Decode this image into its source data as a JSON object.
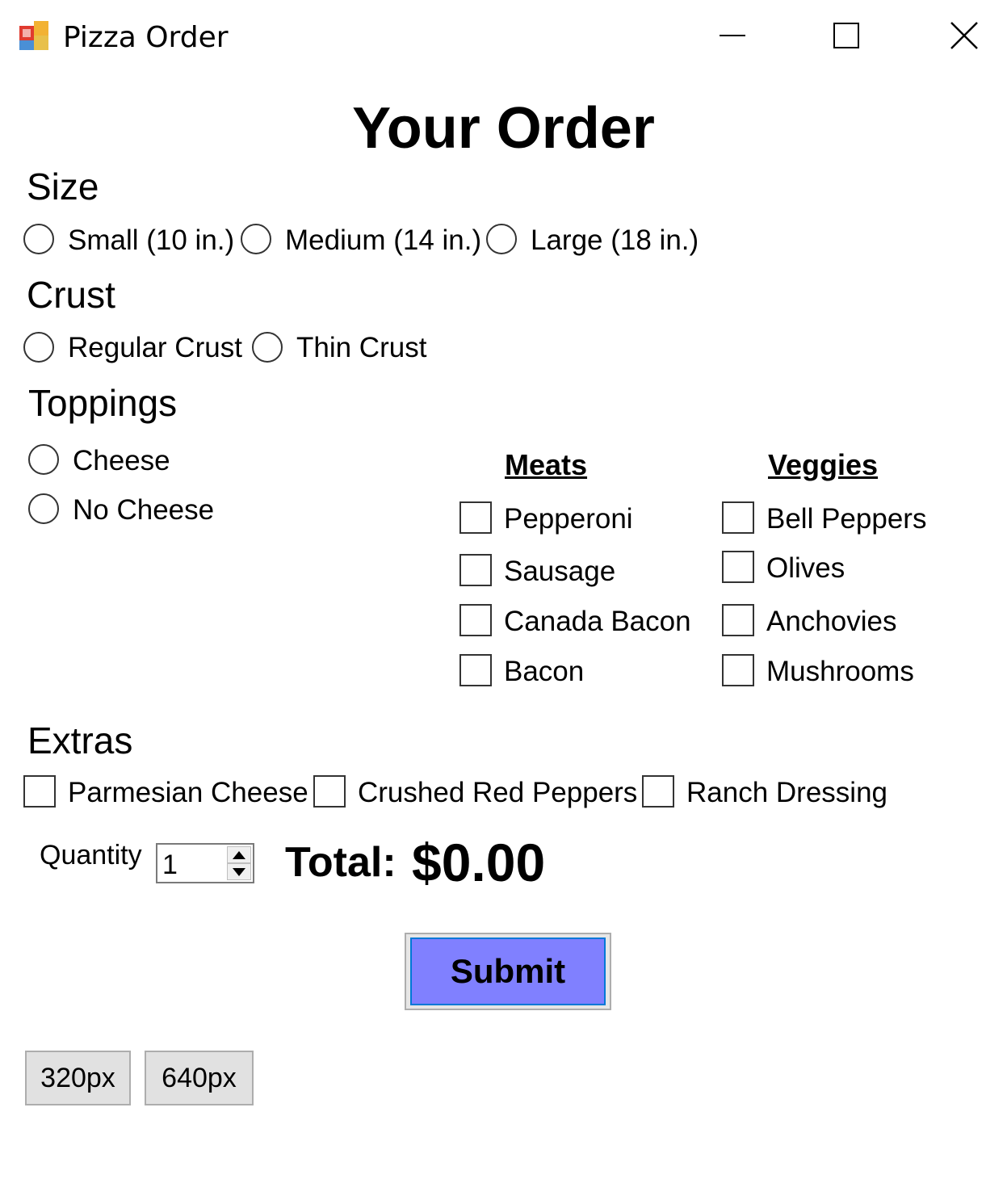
{
  "window": {
    "title": "Pizza Order",
    "icon": "app-icon",
    "controls": [
      "minimize-icon",
      "maximize-icon",
      "close-icon"
    ]
  },
  "heading": "Your Order",
  "size": {
    "label": "Size",
    "options": [
      "Small (10 in.)",
      "Medium (14 in.)",
      "Large (18 in.)"
    ]
  },
  "crust": {
    "label": "Crust",
    "options": [
      "Regular Crust",
      "Thin Crust"
    ]
  },
  "toppings": {
    "label": "Toppings",
    "cheese_options": [
      "Cheese",
      "No Cheese"
    ],
    "meats": {
      "label": "Meats",
      "items": [
        "Pepperoni",
        "Sausage",
        "Canada Bacon",
        "Bacon"
      ]
    },
    "veggies": {
      "label": "Veggies",
      "items": [
        "Bell Peppers",
        "Olives",
        "Anchovies",
        "Mushrooms"
      ]
    }
  },
  "extras": {
    "label": "Extras",
    "items": [
      "Parmesian Cheese",
      "Crushed Red Peppers",
      "Ranch Dressing"
    ]
  },
  "quantity": {
    "label": "Quantity",
    "value": "1"
  },
  "total": {
    "label": "Total:",
    "value": "$0.00"
  },
  "submit_label": "Submit",
  "size_buttons": [
    "320px",
    "640px"
  ],
  "colors": {
    "submit_bg": "#8080ff",
    "submit_border": "#0078d7",
    "button_bg": "#e1e1e1"
  }
}
